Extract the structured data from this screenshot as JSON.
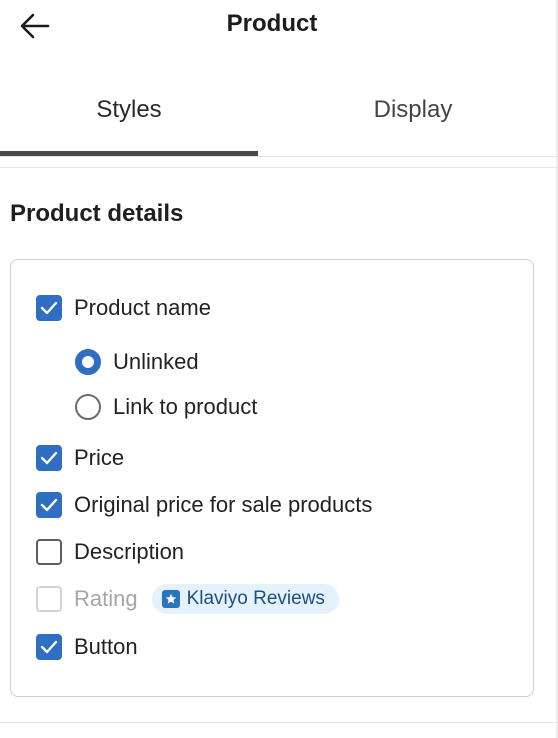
{
  "header": {
    "back_icon": "arrow-left-icon",
    "title": "Product"
  },
  "tabs": [
    {
      "label": "Styles",
      "active": true
    },
    {
      "label": "Display",
      "active": false
    }
  ],
  "section": {
    "title": "Product details"
  },
  "options": {
    "product_name": {
      "label": "Product name",
      "checked": true
    },
    "unlinked": {
      "label": "Unlinked",
      "selected": true
    },
    "link_to_product": {
      "label": "Link to product",
      "selected": false
    },
    "price": {
      "label": "Price",
      "checked": true
    },
    "original_price": {
      "label": "Original price for sale products",
      "checked": true
    },
    "description": {
      "label": "Description",
      "checked": false
    },
    "rating": {
      "label": "Rating",
      "checked": false,
      "disabled": true
    },
    "button": {
      "label": "Button",
      "checked": true
    }
  },
  "badge": {
    "icon": "star-review-icon",
    "label": "Klaviyo Reviews"
  },
  "colors": {
    "accent": "#2e6fc4",
    "badge_bg": "#e6f2fb",
    "badge_text": "#1d4f82",
    "tab_indicator": "#4a4a4a"
  }
}
